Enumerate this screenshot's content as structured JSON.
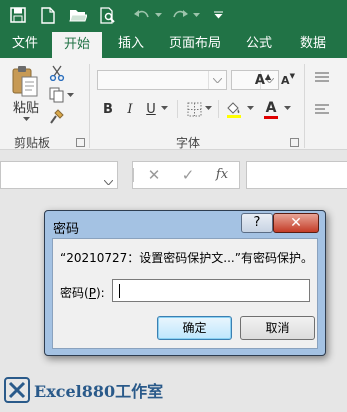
{
  "quick_access": {
    "icons": [
      "save-icon",
      "new-file-icon",
      "open-folder-icon",
      "print-preview-icon",
      "undo-icon",
      "redo-icon",
      "customize-qat-icon"
    ]
  },
  "tabs": [
    {
      "label": "文件"
    },
    {
      "label": "开始",
      "active": true
    },
    {
      "label": "插入"
    },
    {
      "label": "页面布局"
    },
    {
      "label": "公式"
    },
    {
      "label": "数据"
    }
  ],
  "ribbon": {
    "paste_label": "粘贴",
    "clipboard_label": "剪贴板",
    "font_label": "字体",
    "font_size_up": "A",
    "font_size_down": "A",
    "bold": "B",
    "italic": "I",
    "underline": "U",
    "font_color": "A",
    "phonetic": "文"
  },
  "formula_bar": {
    "cancel": "✕",
    "enter": "✓",
    "fx": "fx"
  },
  "dialog": {
    "title": "密码",
    "help": "?",
    "close": "✕",
    "message": "“20210727：设置密码保护文...”有密码保护。",
    "password_label_pre": "密码(",
    "password_label_key": "P",
    "password_label_post": "):",
    "password_value": "",
    "ok_label": "确定",
    "cancel_label": "取消"
  },
  "watermark": {
    "text": "Excel880工作室"
  },
  "colors": {
    "excel_green": "#217346",
    "dialog_frame": "#a4c2e3",
    "close_red": "#c43c27"
  }
}
